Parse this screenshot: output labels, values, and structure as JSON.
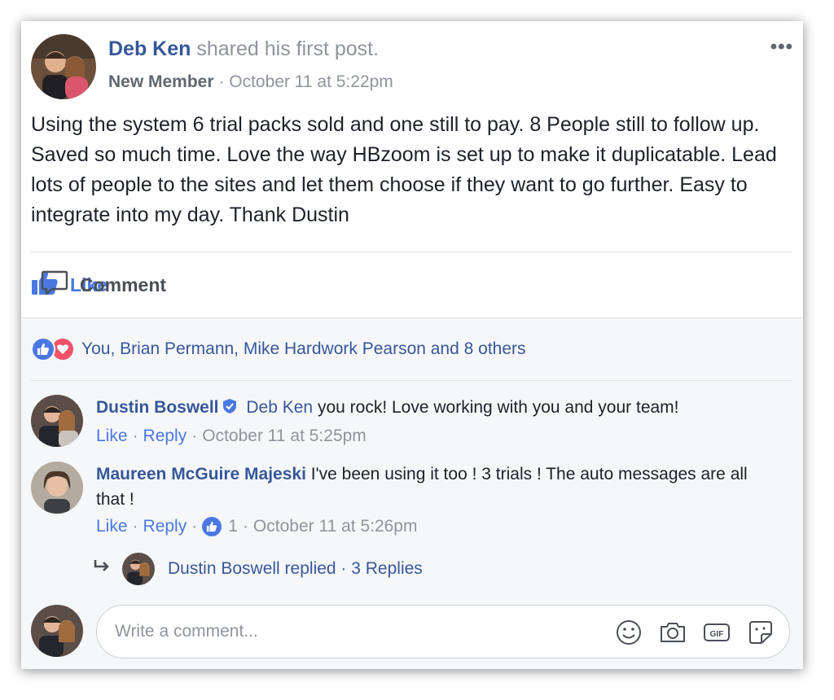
{
  "post": {
    "author": "Deb Ken",
    "action": "shared his first post.",
    "badge": "New Member",
    "separator": "·",
    "time": "October 11 at 5:22pm",
    "more": "•••",
    "text": "Using the system 6 trial packs sold and one still to pay. 8 People still to follow up. Saved so much time. Love the way HBzoom is set up to make it duplicatable. Lead lots of people to the sites and let them choose if they want to go further. Easy to integrate into my day. Thank Dustin"
  },
  "actions": {
    "like": "Like",
    "comment": "Comment"
  },
  "reactions": {
    "summary": "You, Brian Permann, Mike Hardwork Pearson and 8 others"
  },
  "comments": [
    {
      "name": "Dustin Boswell",
      "tag": "Deb Ken",
      "text": "you rock! Love working with you and your team!",
      "like": "Like",
      "reply": "Reply",
      "time": "October 11 at 5:25pm"
    },
    {
      "name": "Maureen McGuire Majeski",
      "text": "I've been using it too ! 3 trials ! The auto messages are all that !",
      "like": "Like",
      "reply": "Reply",
      "like_count": "1",
      "time": "October 11 at 5:26pm"
    }
  ],
  "replies": {
    "text": "Dustin Boswell replied · 3 Replies"
  },
  "composer": {
    "placeholder": "Write a comment..."
  },
  "icons": {
    "more": "more-options-icon",
    "like": "thumbs-up-icon",
    "comment": "speech-bubble-icon",
    "love": "heart-icon",
    "verified": "shield-check-icon",
    "reply_arrow": "reply-arrow-icon",
    "emoji": "smiley-icon",
    "camera": "camera-icon",
    "gif": "gif-icon",
    "sticker": "sticker-icon"
  },
  "colors": {
    "link": "#365899",
    "accent": "#4a78e2",
    "love": "#f25268",
    "muted": "#90949c"
  }
}
